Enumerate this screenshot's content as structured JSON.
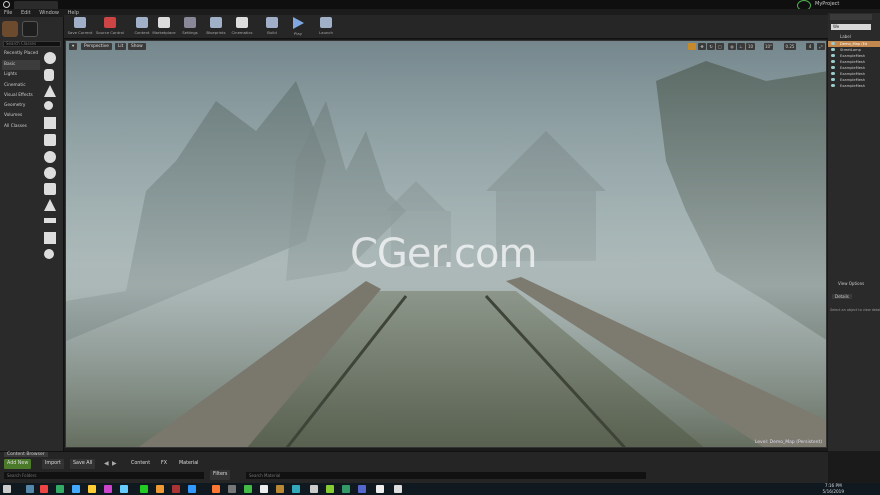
{
  "window": {
    "project_name": "MyProject"
  },
  "menu": [
    "File",
    "Edit",
    "Window",
    "Help"
  ],
  "modes": {
    "search_placeholder": "Search Classes",
    "categories": [
      "Recently Placed",
      "Basic",
      "Lights",
      "Cinematic",
      "Visual Effects",
      "Geometry",
      "Volumes",
      "All Classes"
    ],
    "active": "Basic"
  },
  "toolbar": [
    {
      "label": "Save Current",
      "icon": "save-icon"
    },
    {
      "label": "Source Control",
      "icon": "source-control-icon"
    },
    {
      "label": "Content",
      "icon": "content-icon"
    },
    {
      "label": "Marketplace",
      "icon": "marketplace-icon"
    },
    {
      "label": "Settings",
      "icon": "settings-icon"
    },
    {
      "label": "Blueprints",
      "icon": "blueprints-icon"
    },
    {
      "label": "Cinematics",
      "icon": "cinematics-icon"
    },
    {
      "label": "Build",
      "icon": "build-icon"
    },
    {
      "label": "Play",
      "icon": "play-icon"
    },
    {
      "label": "Launch",
      "icon": "launch-icon"
    }
  ],
  "viewport": {
    "perspective": "Perspective",
    "lit": "Lit",
    "show": "Show",
    "snap_values": [
      "10",
      "10°",
      "0.25",
      "4"
    ],
    "camera_speed": "4",
    "level_label": "Level: Demo_Map (Persistent)"
  },
  "watermark": "CGer.com",
  "outliner": {
    "search_value": "We",
    "column_label": "Label",
    "rows": [
      "Demo_Map (Ed",
      "StreetLamp",
      "ExampleMesh",
      "ExampleMesh",
      "ExampleMesh",
      "ExampleMesh",
      "ExampleMesh",
      "ExampleMesh"
    ],
    "view_options": "View Options"
  },
  "details": {
    "tab": "Details",
    "empty_text": "Select an object to view details."
  },
  "content_browser": {
    "tab": "Content Browser",
    "add_new": "Add New",
    "import": "Import",
    "save_all": "Save All",
    "breadcrumb": [
      "Content",
      "FX",
      "Material"
    ],
    "filters": "Filters",
    "search_placeholder": "Search Material",
    "search_paths_placeholder": "Search Folders"
  },
  "taskbar": {
    "time": "7:16 PM",
    "date": "5/16/2019"
  }
}
